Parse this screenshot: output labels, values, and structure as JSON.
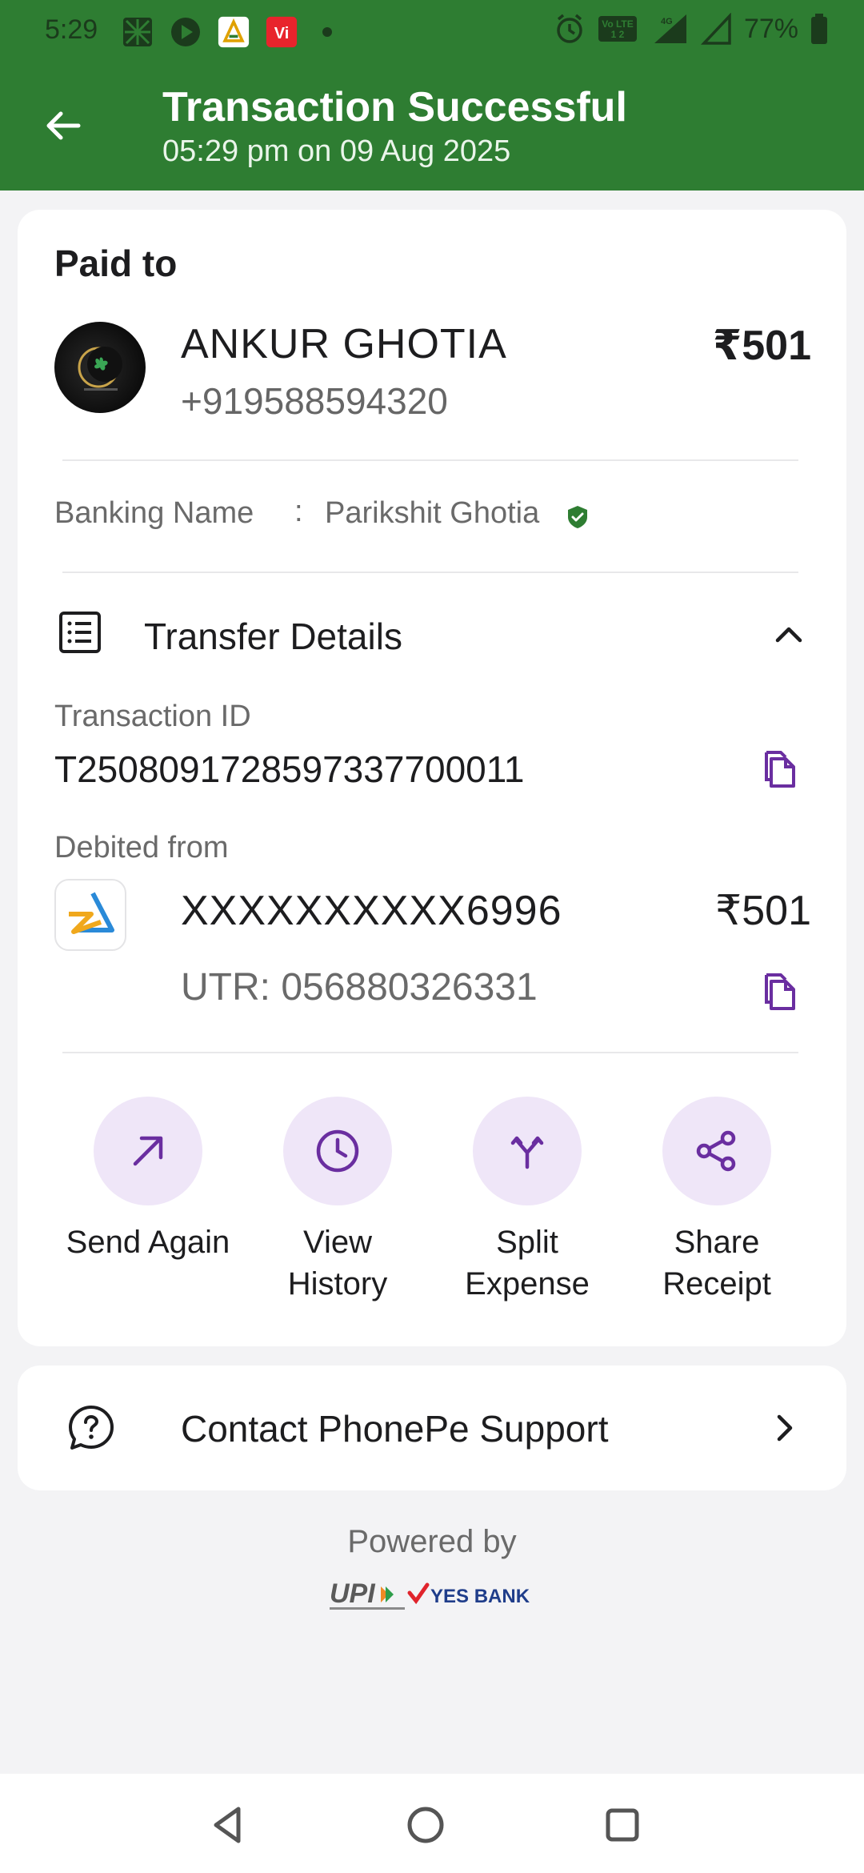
{
  "status_bar": {
    "time": "5:29",
    "battery": "77%"
  },
  "header": {
    "title": "Transaction Successful",
    "subtitle": "05:29 pm on 09 Aug 2025"
  },
  "payee": {
    "section_label": "Paid to",
    "name": "ANKUR GHOTIA",
    "phone": "+919588594320",
    "amount": "₹501",
    "banking_label": "Banking Name",
    "banking_colon": ":",
    "banking_name": "Parikshit Ghotia"
  },
  "transfer": {
    "label": "Transfer Details",
    "txid_label": "Transaction ID",
    "txid": "T2508091728597337700011",
    "debited_label": "Debited from",
    "account": "XXXXXXXXXX6996",
    "account_amount": "₹501",
    "utr": "UTR: 056880326331"
  },
  "actions": [
    {
      "label": "Send Again",
      "icon": "arrow-up-right-icon"
    },
    {
      "label": "View\nHistory",
      "icon": "clock-icon"
    },
    {
      "label": "Split\nExpense",
      "icon": "split-icon"
    },
    {
      "label": "Share\nReceipt",
      "icon": "share-icon"
    }
  ],
  "action_labels": {
    "send": [
      "Send Again"
    ],
    "history": [
      "View",
      "History"
    ],
    "split": [
      "Split",
      "Expense"
    ],
    "share": [
      "Share",
      "Receipt"
    ]
  },
  "support": {
    "label": "Contact PhonePe Support"
  },
  "footer": {
    "powered_by": "Powered by"
  },
  "colors": {
    "header_green": "#2e7d32",
    "accent_purple": "#6a2ea0",
    "icon_bg": "#efe6f8"
  }
}
